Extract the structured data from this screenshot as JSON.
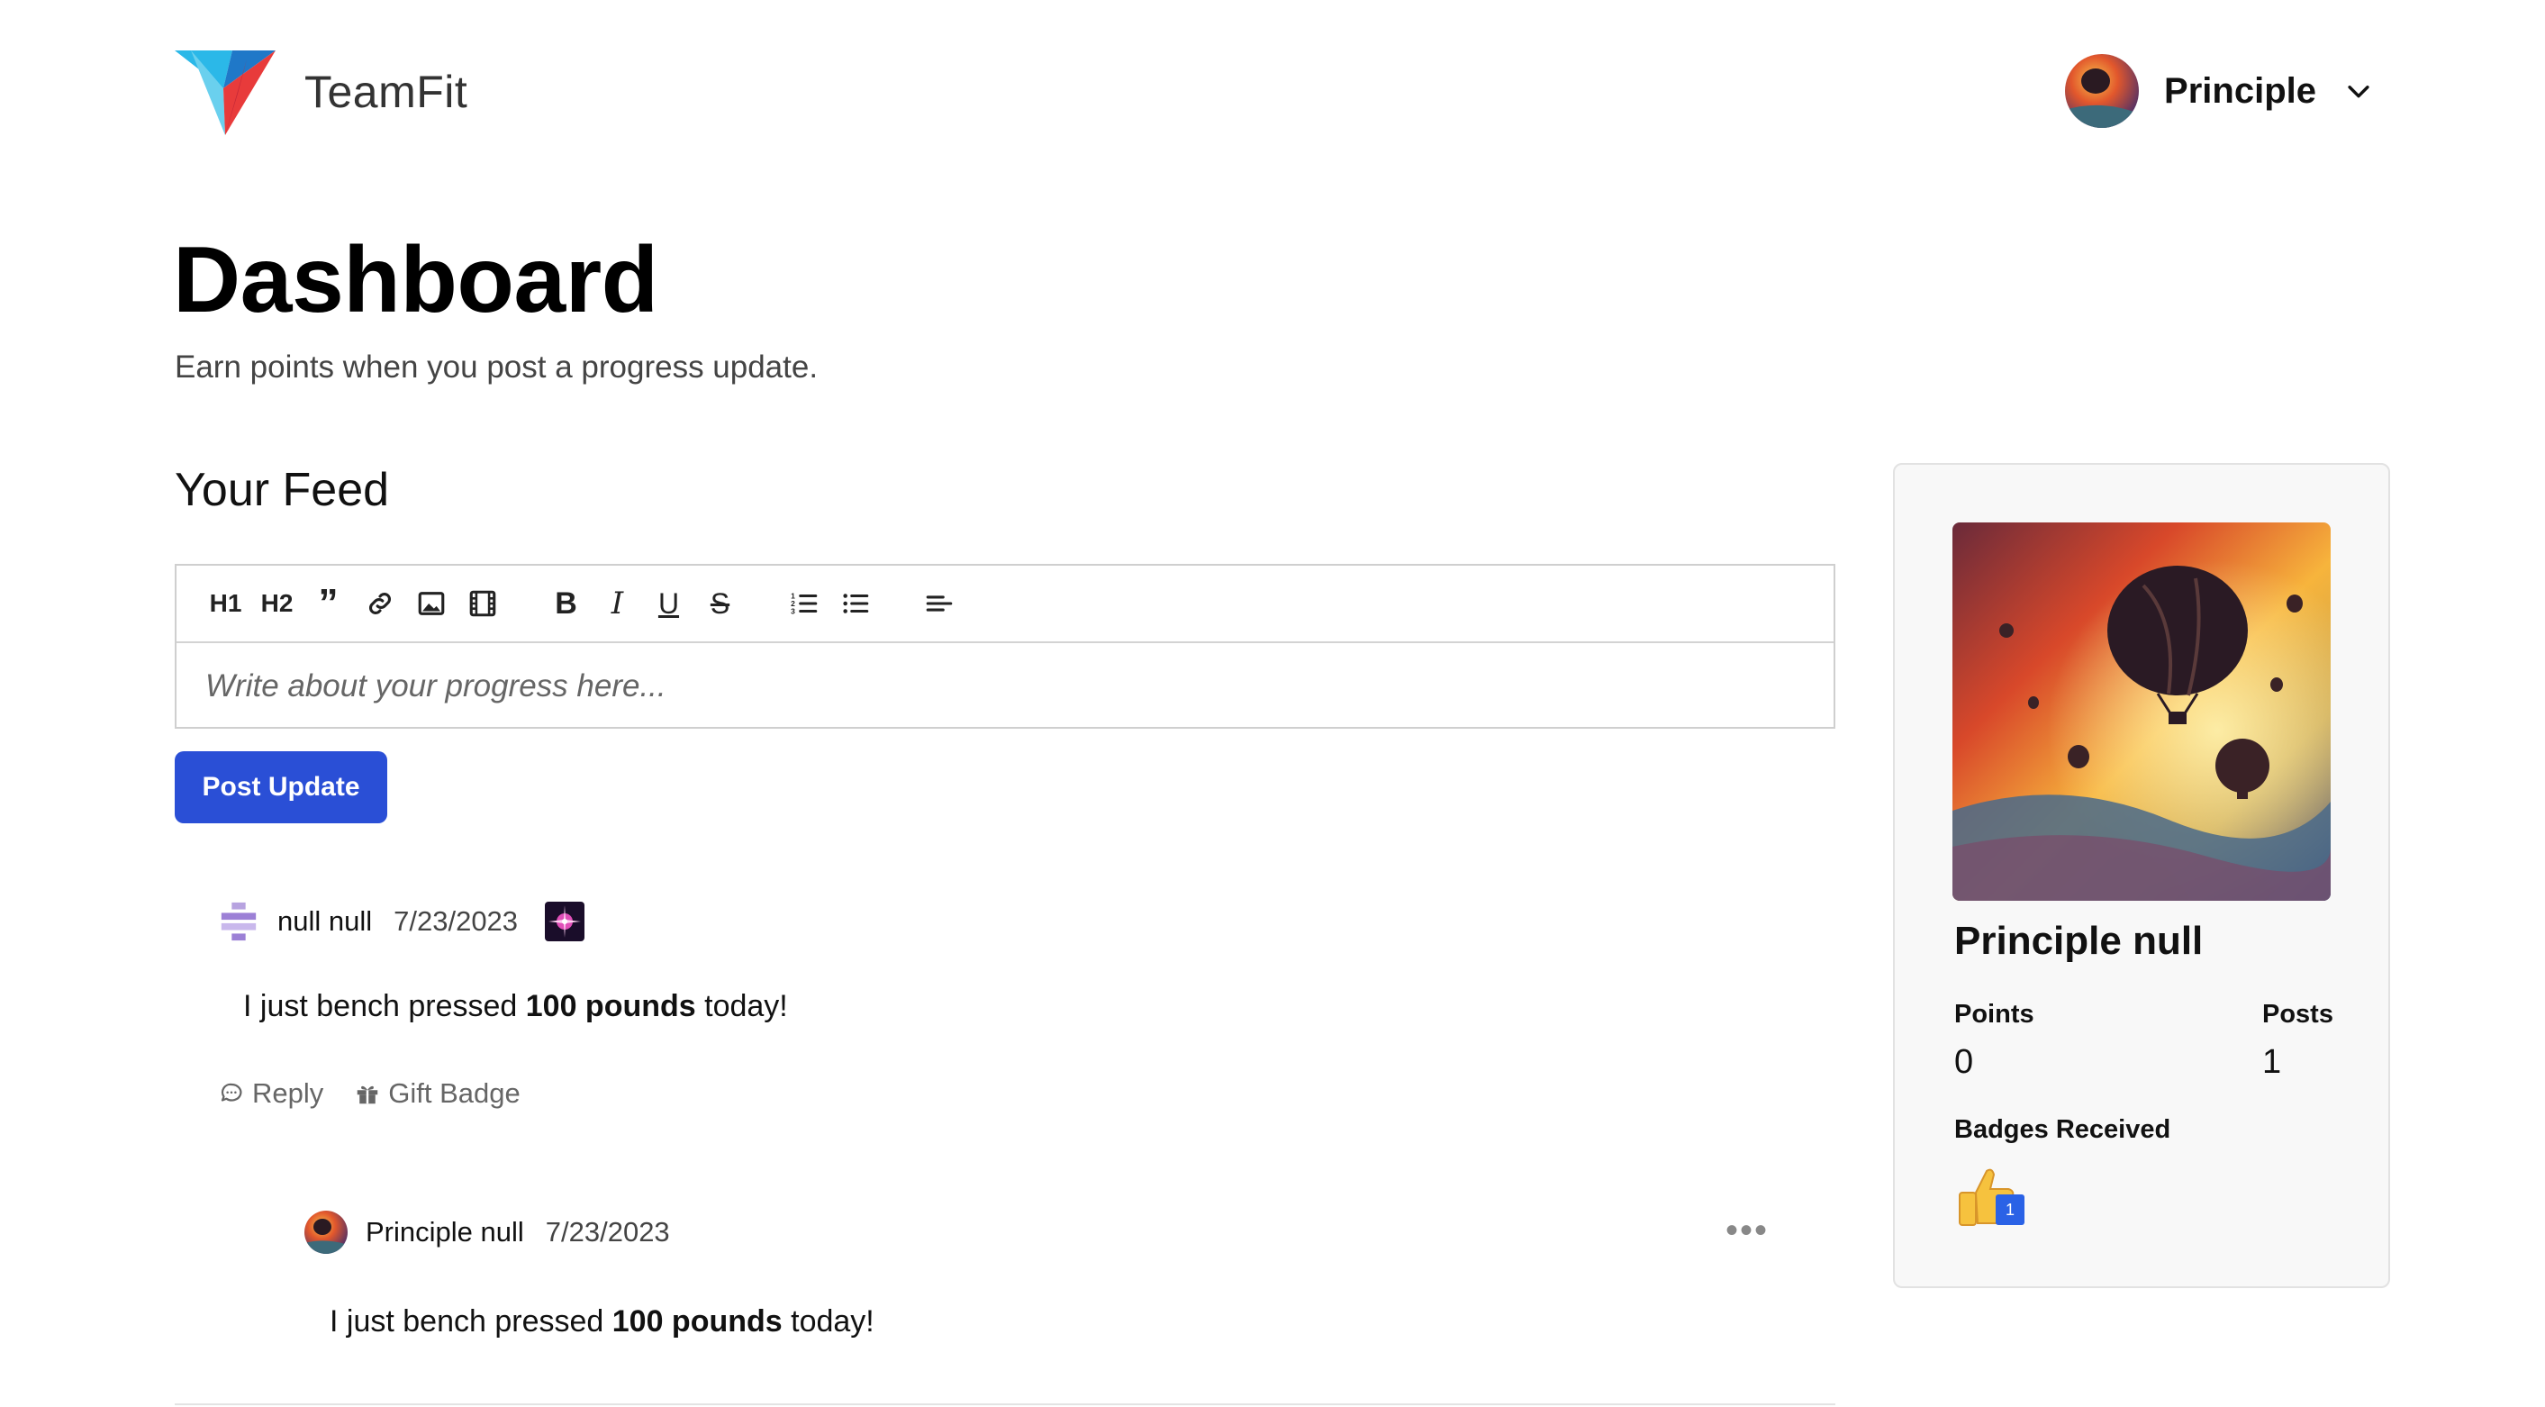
{
  "header": {
    "brand": "TeamFit",
    "user_name": "Principle"
  },
  "page": {
    "title": "Dashboard",
    "subtitle": "Earn points when you post a progress update."
  },
  "feed": {
    "title": "Your Feed",
    "editor": {
      "toolbar": [
        {
          "icon": "heading-1-icon",
          "label": "H1"
        },
        {
          "icon": "heading-2-icon",
          "label": "H2"
        },
        {
          "icon": "quote-icon"
        },
        {
          "icon": "link-icon"
        },
        {
          "icon": "image-icon"
        },
        {
          "icon": "video-icon"
        },
        {
          "icon": "bold-icon",
          "label": "B"
        },
        {
          "icon": "italic-icon",
          "label": "I"
        },
        {
          "icon": "underline-icon",
          "label": "U"
        },
        {
          "icon": "strikethrough-icon",
          "label": "S"
        },
        {
          "icon": "ordered-list-icon"
        },
        {
          "icon": "bullet-list-icon"
        },
        {
          "icon": "align-left-icon"
        }
      ],
      "placeholder": "Write about your progress here..."
    },
    "post_button": "Post Update",
    "posts": [
      {
        "author": "null null",
        "date": "7/23/2023",
        "body_prefix": "I just bench pressed ",
        "body_bold": "100 pounds",
        "body_suffix": " today!",
        "actions": {
          "reply": "Reply",
          "gift": "Gift Badge"
        }
      },
      {
        "author": "Principle null",
        "date": "7/23/2023",
        "body_prefix": "I just bench pressed ",
        "body_bold": "100 pounds",
        "body_suffix": " today!",
        "more": "•••"
      }
    ]
  },
  "profile": {
    "name": "Principle null",
    "points_label": "Points",
    "points": "0",
    "posts_label": "Posts",
    "posts": "1",
    "badges_label": "Badges Received",
    "badges": [
      {
        "icon": "thumbs-up-icon",
        "count": "1"
      }
    ]
  },
  "colors": {
    "primary": "#2a4fd6",
    "border": "#cfcfcf",
    "card_bg": "#f8f8f8"
  }
}
